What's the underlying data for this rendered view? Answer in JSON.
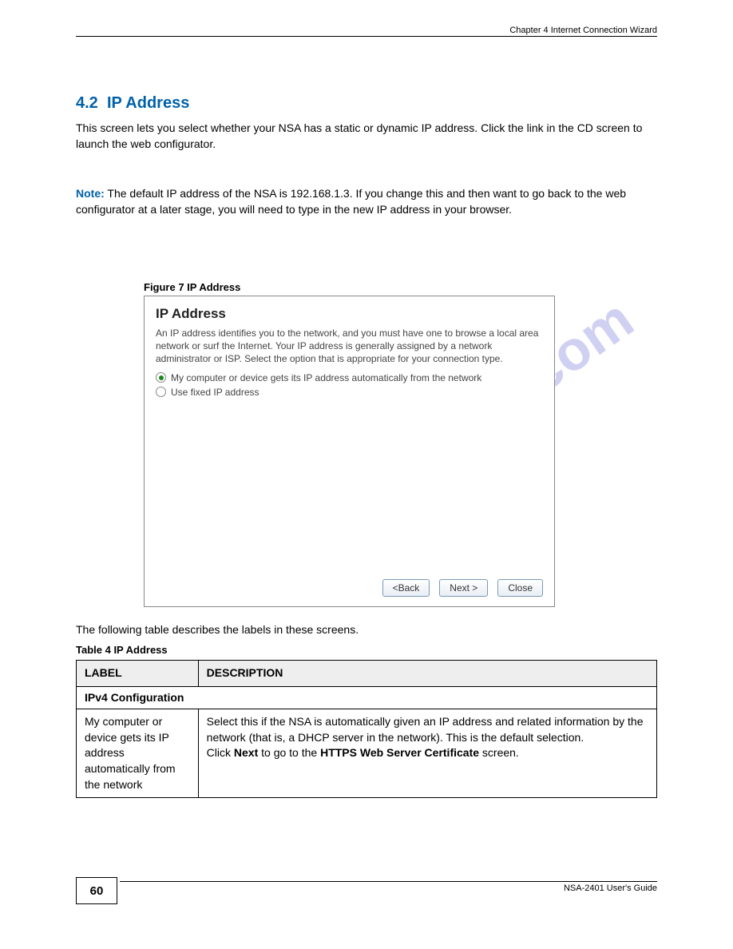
{
  "chapter_header": "Chapter 4 Internet Connection Wizard",
  "section": {
    "number": "4.2",
    "title": "IP Address",
    "paragraph": "This screen lets you select whether your NSA has a static or dynamic IP address. Click the link in the CD screen to launch the web configurator.",
    "note_prefix": "Note:",
    "note_text": "The default IP address of the NSA is 192.168.1.3. If you change this and then want to go back to the web configurator at a later stage, you will need to type in the new IP address in your browser."
  },
  "figure_caption": "Figure 7   IP Address",
  "dialog": {
    "title": "IP Address",
    "description": "An IP address identifies you to the network, and you must have one to browse a local area network or surf the Internet. Your IP address is generally assigned by a network administrator or ISP. Select the option that is appropriate for your connection type.",
    "option1": "My computer or device gets its IP address automatically from the network",
    "option2": "Use fixed IP address",
    "back": "<Back",
    "next": "Next >",
    "close": "Close"
  },
  "watermark": "manualshive.com",
  "table_intro": "The following table describes the labels in these screens.",
  "table_caption": "Table 4   IP Address",
  "table": {
    "h1": "LABEL",
    "h2": "DESCRIPTION",
    "section_row": "IPv4 Configuration",
    "row1_label": "My computer or device gets its IP address automatically from the network",
    "row1_desc_line1": "Select this if the NSA is automatically given an IP address and related information by the network (that is, a DHCP server in the network). This is the default selection.",
    "row1_desc_line2": "Click Next to go to the HTTPS Web Server Certificate screen.",
    "next_bold": "Next",
    "https_bold": "HTTPS Web Server Certificate"
  },
  "footer_text": "NSA-2401 User's Guide",
  "page_number": "60"
}
